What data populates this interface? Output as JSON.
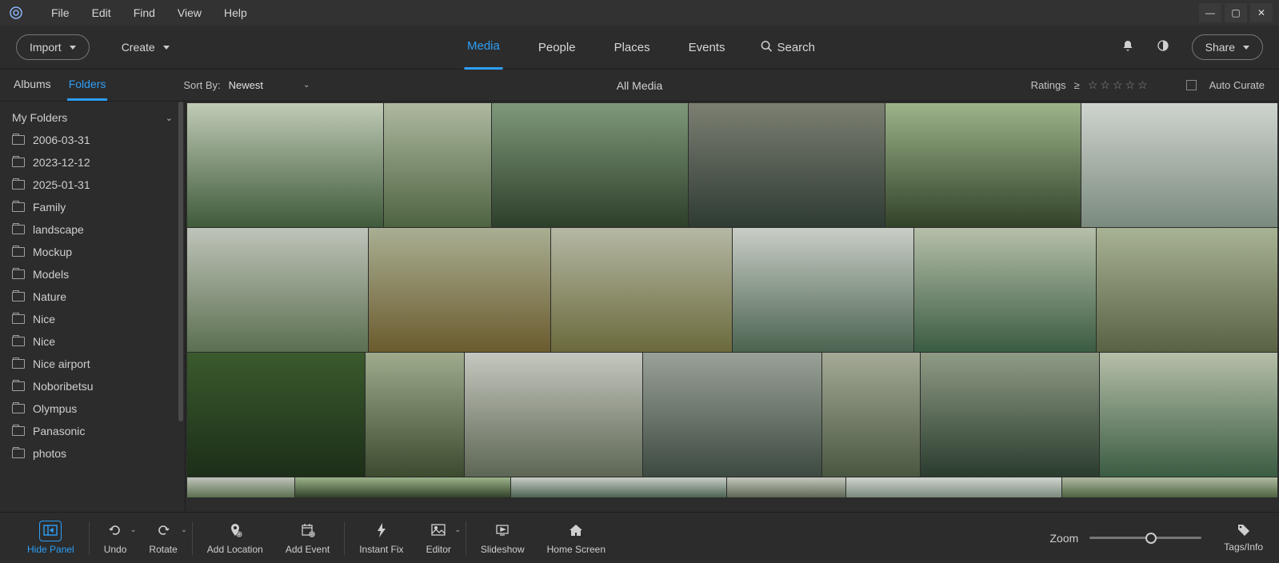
{
  "menus": {
    "file": "File",
    "edit": "Edit",
    "find": "Find",
    "view": "View",
    "help": "Help"
  },
  "toolbar": {
    "import": "Import",
    "create": "Create",
    "tabs": {
      "media": "Media",
      "people": "People",
      "places": "Places",
      "events": "Events"
    },
    "search": "Search",
    "share": "Share"
  },
  "leftTabs": {
    "albums": "Albums",
    "folders": "Folders"
  },
  "sort": {
    "label": "Sort By:",
    "value": "Newest"
  },
  "subbar": {
    "center": "All Media",
    "ratings": "Ratings",
    "gte": "≥",
    "autoCurate": "Auto Curate"
  },
  "sidebar": {
    "header": "My Folders",
    "items": [
      "2006-03-31",
      "2023-12-12",
      "2025-01-31",
      "Family",
      "landscape",
      "Mockup",
      "Models",
      "Nature",
      "Nice",
      "Nice",
      "Nice airport",
      "Noboribetsu",
      "Olympus",
      "Panasonic",
      "photos"
    ]
  },
  "bottom": {
    "hidePanel": "Hide Panel",
    "undo": "Undo",
    "rotate": "Rotate",
    "addLocation": "Add Location",
    "addEvent": "Add Event",
    "instantFix": "Instant Fix",
    "editor": "Editor",
    "slideshow": "Slideshow",
    "homeScreen": "Home Screen",
    "zoom": "Zoom",
    "tagsInfo": "Tags/Info"
  }
}
